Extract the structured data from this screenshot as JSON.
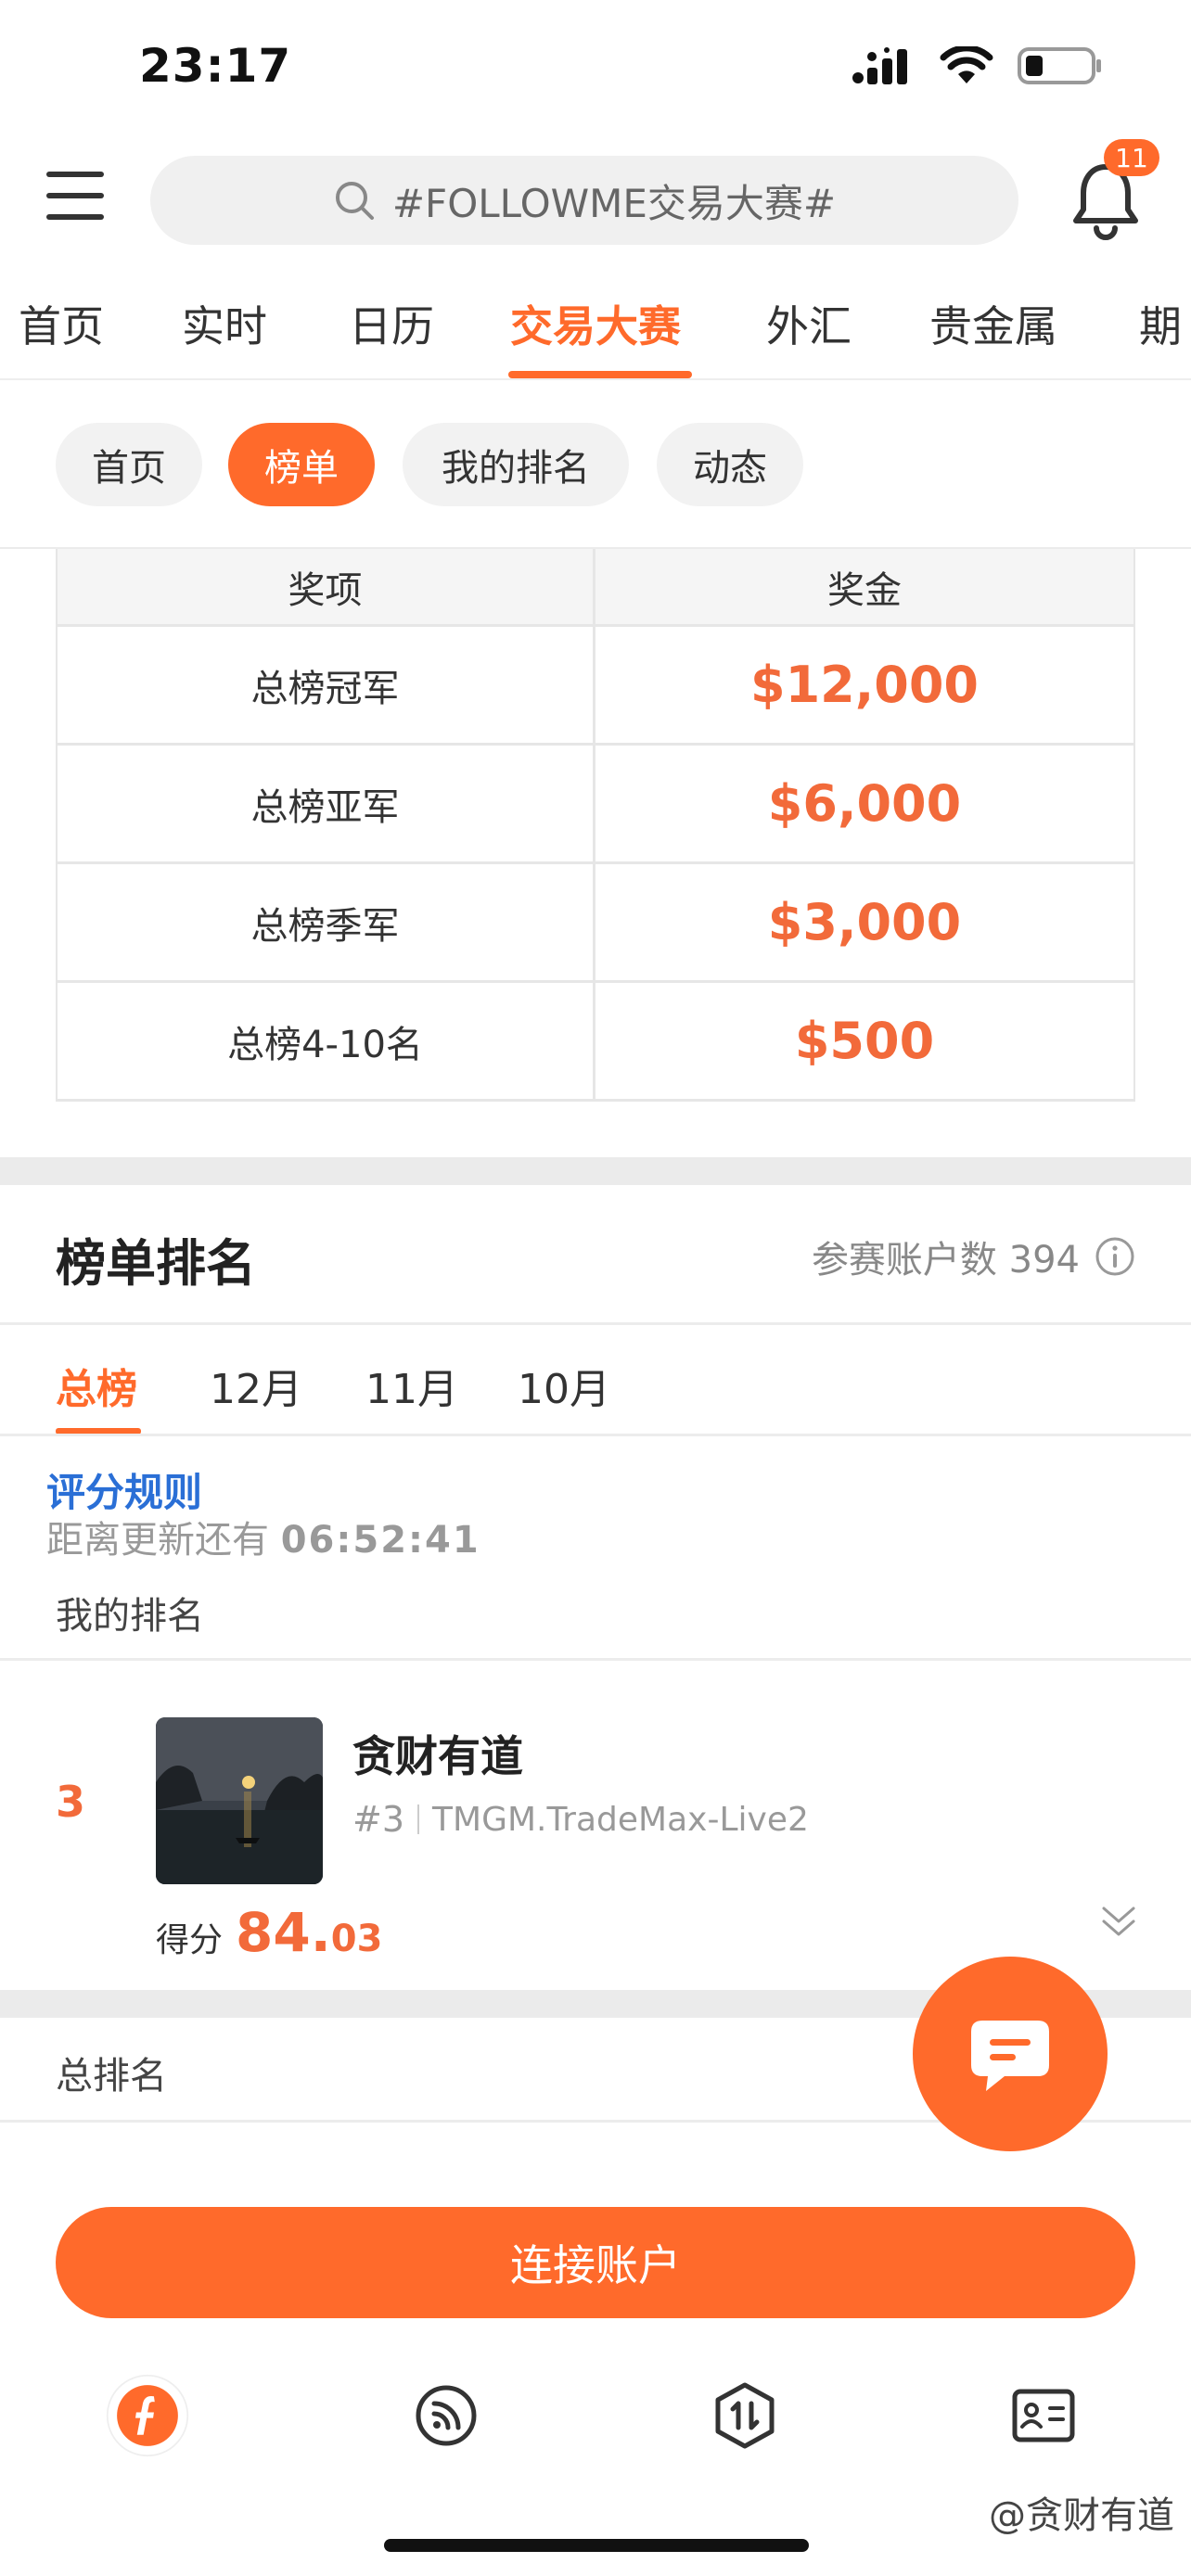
{
  "status_bar": {
    "time": "23:17"
  },
  "header": {
    "search_placeholder": "#FOLLOWME交易大赛#",
    "notification_count": "11"
  },
  "top_nav": {
    "items": [
      "首页",
      "实时",
      "日历",
      "交易大赛",
      "外汇",
      "贵金属",
      "期"
    ],
    "active_index": 3
  },
  "sub_nav": {
    "items": [
      "首页",
      "榜单",
      "我的排名",
      "动态"
    ],
    "active_index": 1
  },
  "prize_table": {
    "headers": [
      "奖项",
      "奖金"
    ],
    "rows": [
      {
        "award": "总榜冠军",
        "prize": "$12,000"
      },
      {
        "award": "总榜亚军",
        "prize": "$6,000"
      },
      {
        "award": "总榜季军",
        "prize": "$3,000"
      },
      {
        "award": "总榜4-10名",
        "prize": "$500"
      }
    ]
  },
  "ranking": {
    "title": "榜单排名",
    "participants_label": "参赛账户数 394",
    "tabs": [
      "总榜",
      "12月",
      "11月",
      "10月"
    ],
    "active_tab": 0,
    "rule_link": "评分规则",
    "countdown_label": "距离更新还有",
    "countdown_value": "06:52:41",
    "my_rank_label": "我的排名",
    "total_rank_label": "总排名"
  },
  "my_entry": {
    "rank": "3",
    "name": "贪财有道",
    "rank_tag": "#3",
    "account": "TMGM.TradeMax-Live2",
    "score_label": "得分",
    "score_int": "84.",
    "score_dec": "03"
  },
  "connect_button": "连接账户",
  "tab_bar": {
    "icons": [
      "followme-logo-icon",
      "feed-icon",
      "trade-icon",
      "profile-card-icon"
    ]
  },
  "watermark": "@贪财有道",
  "colors": {
    "accent": "#ff6a2b",
    "link": "#2a6fd6",
    "prize": "#f26a3a"
  }
}
